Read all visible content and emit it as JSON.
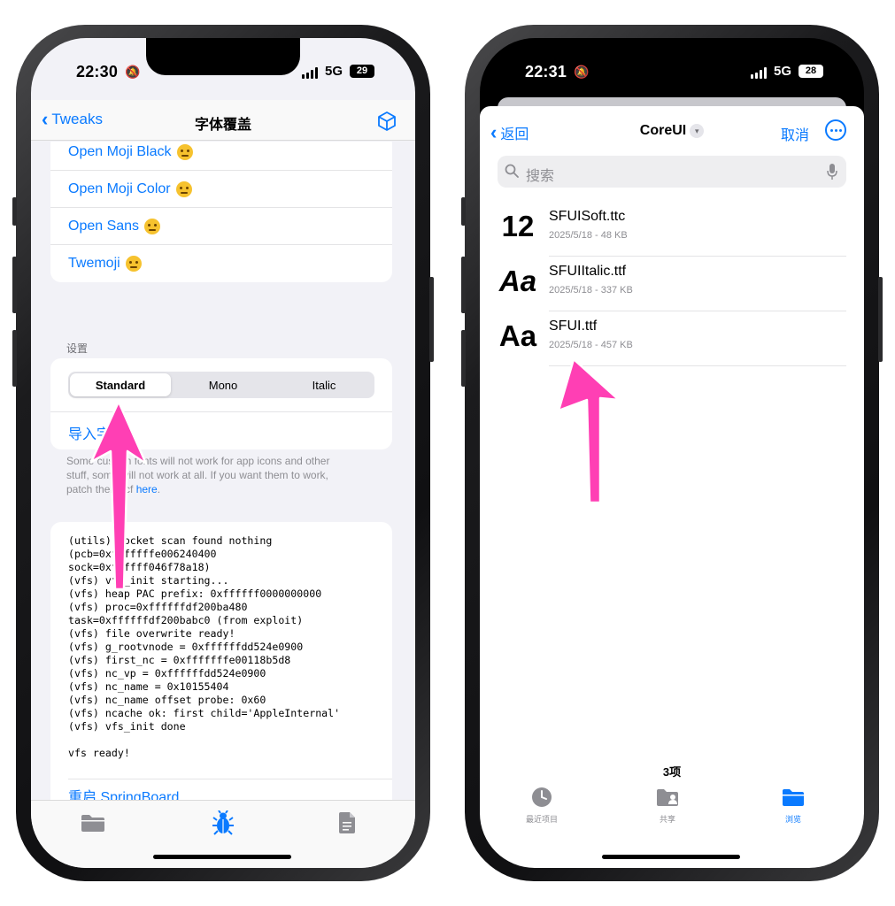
{
  "left_phone": {
    "status": {
      "time": "22:30",
      "network": "5G",
      "battery": "29"
    },
    "nav": {
      "back_label": "Tweaks",
      "title": "字体覆盖"
    },
    "fonts": [
      {
        "label": "Open Moji Black"
      },
      {
        "label": "Open Moji Color"
      },
      {
        "label": "Open Sans"
      },
      {
        "label": "Twemoji"
      }
    ],
    "settings": {
      "section_label": "设置",
      "segments": [
        "Standard",
        "Mono",
        "Italic"
      ],
      "selected_segment": "Standard",
      "import_label": "导入字体"
    },
    "footnote": {
      "line1": "Some custom fonts will not work for app icons and other",
      "line2": "stuff, some will not work at all. If you want them to work,",
      "line3": "patch them, cf ",
      "link": "here",
      "end": "."
    },
    "log": [
      "(utils) socket scan found nothing",
      "(pcb=0xfffffffe006240400",
      "sock=0xffffff046f78a18)",
      "(vfs) vfs_init starting...",
      "(vfs) heap PAC prefix: 0xffffff0000000000",
      "(vfs) proc=0xffffffdf200ba480",
      "task=0xffffffdf200babc0 (from exploit)",
      "(vfs) file overwrite ready!",
      "(vfs) g_rootvnode = 0xffffffdd524e0900",
      "(vfs) first_nc = 0xfffffffe00118b5d8",
      "(vfs) nc_vp = 0xffffffdd524e0900",
      "(vfs) nc_name = 0x10155404",
      "(vfs) nc_name offset probe: 0x60",
      "(vfs) ncache ok: first child='AppleInternal'",
      "(vfs) vfs_init done",
      "",
      "vfs ready!"
    ],
    "restart_label": "重启 SpringBoard",
    "tabbar": [
      "folder-icon",
      "bug-icon",
      "document-icon"
    ],
    "selected_tab": "bug-icon"
  },
  "right_phone": {
    "status": {
      "time": "22:31",
      "network": "5G",
      "battery": "28"
    },
    "nav": {
      "back_label": "返回",
      "title": "CoreUI",
      "cancel_label": "取消"
    },
    "search": {
      "placeholder": "搜索"
    },
    "files": [
      {
        "thumb": "12",
        "name": "SFUISoft.ttc",
        "meta": "2025/5/18 - 48 KB"
      },
      {
        "thumb": "Aa",
        "name": "SFUIItalic.ttf",
        "meta": "2025/5/18 - 337 KB"
      },
      {
        "thumb": "Aa",
        "name": "SFUI.ttf",
        "meta": "2025/5/18 - 457 KB"
      }
    ],
    "item_count": "3项",
    "tabbar": [
      {
        "label": "最近项目",
        "icon": "clock-icon"
      },
      {
        "label": "共享",
        "icon": "shared-folder-icon"
      },
      {
        "label": "浏览",
        "icon": "folder-icon"
      }
    ],
    "selected_tab": "浏览"
  },
  "colors": {
    "accent": "#0a7aff",
    "arrow": "#ff3fb4",
    "background": "#f2f2f7"
  }
}
